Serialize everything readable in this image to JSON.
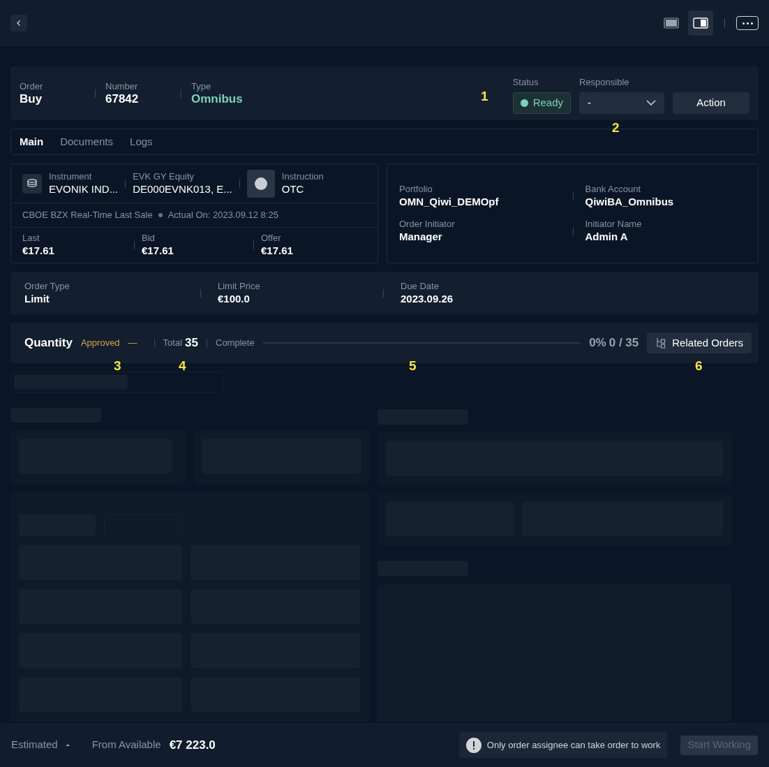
{
  "header": {
    "fields": [
      {
        "label": "Order",
        "value": "Buy",
        "kind": "plain"
      },
      {
        "label": "Number",
        "value": "67842",
        "kind": "plain"
      },
      {
        "label": "Type",
        "value": "Omnibus",
        "kind": "accent"
      }
    ],
    "status": {
      "label": "Status",
      "value": "Ready",
      "color": "#7fd1bd"
    },
    "responsible": {
      "label": "Responsible",
      "value": "-"
    },
    "action": "Action"
  },
  "tabs": [
    {
      "label": "Main",
      "selected": true
    },
    {
      "label": "Documents",
      "selected": false
    },
    {
      "label": "Logs",
      "selected": false
    }
  ],
  "instrument": {
    "items": [
      {
        "label": "Instrument",
        "value": "EVONIK IND...",
        "kind": "coins"
      },
      {
        "label": "EVK GY Equity",
        "value": "DE000EVNK013, E...",
        "kind": "plain"
      },
      {
        "label": "Instruction",
        "value": "OTC",
        "kind": "circle"
      }
    ],
    "source": "CBOE BZX Real-Time Last Sale",
    "actual": "Actual On: 2023.09.12 8:25",
    "prices": [
      {
        "label": "Last",
        "value": "€17.61"
      },
      {
        "label": "Bid",
        "value": "€17.61"
      },
      {
        "label": "Offer",
        "value": "€17.61"
      }
    ]
  },
  "details": [
    {
      "label": "Portfolio",
      "value": "OMN_Qiwi_DEMOpf"
    },
    {
      "label": "Bank Account",
      "value": "QiwiBA_Omnibus"
    },
    {
      "label": "Order Initiator",
      "value": "Manager"
    },
    {
      "label": "Initiator Name",
      "value": "Admin A"
    }
  ],
  "order_terms": [
    {
      "label": "Order Type",
      "value": "Limit"
    },
    {
      "label": "Limit Price",
      "value": "€100.0"
    },
    {
      "label": "Due Date",
      "value": "2023.09.26"
    }
  ],
  "quantity": {
    "title": "Quantity",
    "approved_label": "Approved",
    "approved_value": "—",
    "total_label": "Total",
    "total_value": "35",
    "complete_label": "Complete",
    "level": 0,
    "percent": "0%",
    "count": "0 / 35",
    "related": "Related Orders"
  },
  "annotations": [
    "1",
    "2",
    "3",
    "4",
    "5",
    "6"
  ],
  "footer": {
    "estimated_label": "Estimated",
    "estimated_value": "-",
    "available_label": "From Available",
    "available_value": "€7 223.0",
    "notice": "Only order assignee can take order to work",
    "start": "Start Working",
    "start_disabled": true
  }
}
